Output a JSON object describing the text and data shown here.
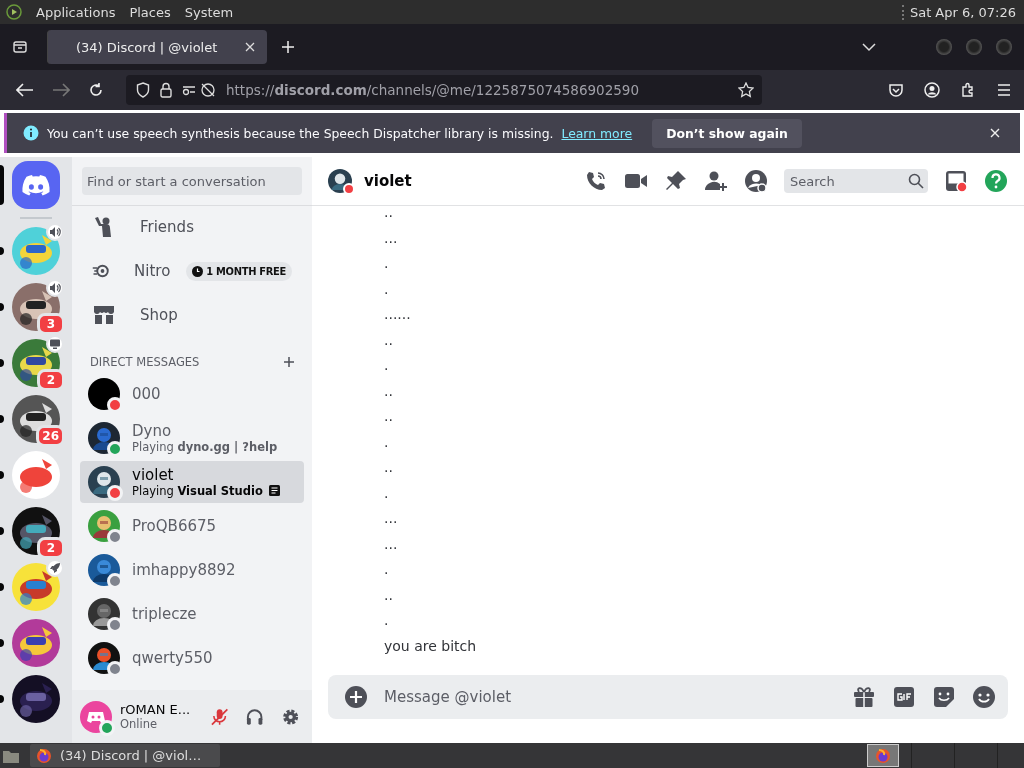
{
  "desktop_panel": {
    "menus": [
      "Applications",
      "Places",
      "System"
    ],
    "clock": "Sat Apr 6, 07:26"
  },
  "browser": {
    "tabs": [
      {
        "title": "(34) Discord | @violet",
        "selected": true
      }
    ],
    "url": "https://**discord.com**/channels/@me/1225875074586902590",
    "notification": {
      "message": "You can’t use speech synthesis because the Speech Dispatcher library is missing.",
      "link": "Learn more",
      "button": "Don’t show again"
    }
  },
  "servers": [
    {
      "kind": "home",
      "selected": true
    },
    {
      "kind": "voice",
      "selected": false,
      "unread": true
    },
    {
      "kind": "voice",
      "selected": false,
      "unread": true,
      "badge": "3"
    },
    {
      "kind": "streaming",
      "selected": false,
      "unread": true,
      "badge": "2"
    },
    {
      "kind": "server",
      "selected": false,
      "unread": true,
      "badge": "26"
    },
    {
      "kind": "server",
      "selected": false,
      "unread": true
    },
    {
      "kind": "server",
      "selected": false,
      "unread": true,
      "badge": "2"
    },
    {
      "kind": "activity",
      "selected": false,
      "unread": true
    },
    {
      "kind": "server",
      "selected": false,
      "unread": true
    },
    {
      "kind": "server",
      "selected": false,
      "unread": true
    }
  ],
  "sidebar": {
    "search": {
      "placeholder": "Find or start a conversation"
    },
    "nav": [
      {
        "kind": "friends",
        "label": "Friends"
      },
      {
        "kind": "nitro",
        "label": "Nitro",
        "badge": "1 MONTH FREE"
      },
      {
        "kind": "shop",
        "label": "Shop"
      }
    ],
    "dm_header": "DIRECT MESSAGES",
    "dms": [
      {
        "name": "000",
        "color": "#f23f43",
        "selected": false
      },
      {
        "name": "Dyno",
        "color": "#23a55a",
        "activity": "Playing **dyno.gg | ?help**",
        "selected": false
      },
      {
        "name": "violet",
        "color": "#f23f43",
        "activity": "Playing **Visual Studio**",
        "rich_presence": true,
        "selected": true
      },
      {
        "name": "ProQB6675",
        "color": "#80848e",
        "selected": false
      },
      {
        "name": "imhappy8892",
        "color": "#80848e",
        "selected": false
      },
      {
        "name": "triplecze",
        "color": "#80848e",
        "selected": false
      },
      {
        "name": "qwerty550",
        "color": "#80848e",
        "selected": false
      }
    ],
    "user": {
      "name": "rOMAN E...",
      "status_text": "Online",
      "color": "#23a55a",
      "muted": true
    }
  },
  "chat": {
    "title": "violet",
    "color": "#f23f43",
    "search_placeholder": "Search",
    "inbox_unread": true,
    "messages": [
      "..",
      "...",
      ".",
      ".",
      "......",
      "..",
      ".",
      "..",
      "..",
      ".",
      "..",
      ".",
      "...",
      "...",
      ".",
      "..",
      ".",
      "you are bitch"
    ],
    "composer_placeholder": "Message @violet"
  },
  "taskbar": {
    "windows": [
      {
        "title": "(34) Discord | @viol…",
        "selected": false
      }
    ]
  }
}
